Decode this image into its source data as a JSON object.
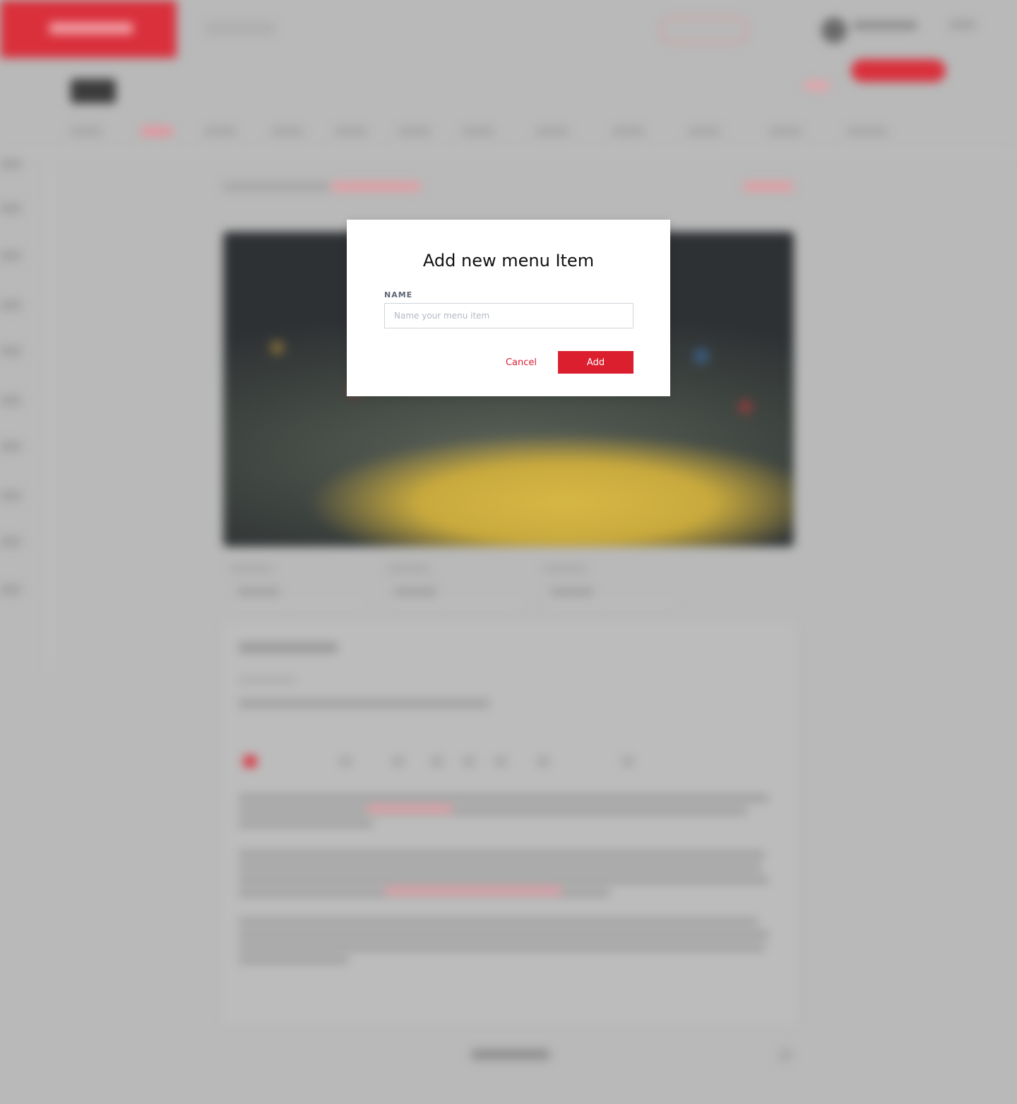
{
  "modal": {
    "title": "Add new menu Item",
    "name_label": "NAME",
    "name_placeholder": "Name your menu item",
    "name_value": "",
    "cancel_label": "Cancel",
    "add_label": "Add"
  },
  "colors": {
    "accent": "#dc1f2f",
    "overlay": "#b9b9b9",
    "modal_background": "#ffffff"
  }
}
